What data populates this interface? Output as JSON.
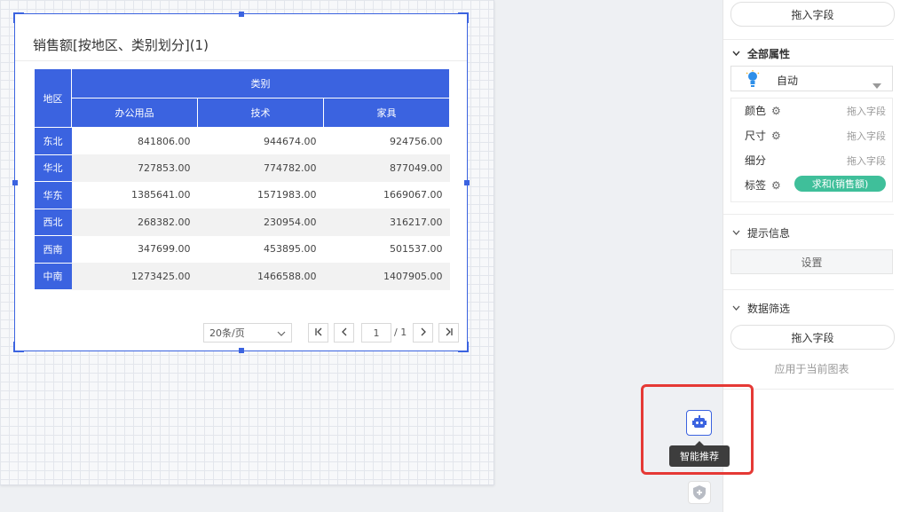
{
  "chart": {
    "title": "销售额[按地区、类别划分](1)",
    "table": {
      "row_header": "地区",
      "group_header": "类别",
      "columns": [
        "办公用品",
        "技术",
        "家具"
      ],
      "rows": [
        {
          "region": "东北",
          "values": [
            "841806.00",
            "944674.00",
            "924756.00"
          ]
        },
        {
          "region": "华北",
          "values": [
            "727853.00",
            "774782.00",
            "877049.00"
          ]
        },
        {
          "region": "华东",
          "values": [
            "1385641.00",
            "1571983.00",
            "1669067.00"
          ]
        },
        {
          "region": "西北",
          "values": [
            "268382.00",
            "230954.00",
            "316217.00"
          ]
        },
        {
          "region": "西南",
          "values": [
            "347699.00",
            "453895.00",
            "501537.00"
          ]
        },
        {
          "region": "中南",
          "values": [
            "1273425.00",
            "1466588.00",
            "1407905.00"
          ]
        }
      ]
    },
    "pagination": {
      "page_size": "20条/页",
      "current_page": "1",
      "total_pages": "/ 1"
    }
  },
  "panel": {
    "drop_top": "拖入字段",
    "all_props_title": "全部属性",
    "mark_type": "自动",
    "props": [
      {
        "label": "颜色",
        "gear": true,
        "hint": "拖入字段"
      },
      {
        "label": "尺寸",
        "gear": true,
        "hint": "拖入字段"
      },
      {
        "label": "细分",
        "gear": false,
        "hint": "拖入字段"
      },
      {
        "label": "标签",
        "gear": true,
        "tag": "求和(销售额)"
      }
    ],
    "tooltip_section": "提示信息",
    "tooltip_button": "设置",
    "filter_section": "数据筛选",
    "filter_drop": "拖入字段",
    "filter_apply": "应用于当前图表"
  },
  "float": {
    "bot_tooltip": "智能推荐"
  },
  "colors": {
    "accent": "#3b63e0",
    "label_tag": "#3fbf9a",
    "highlight": "#e53935"
  }
}
